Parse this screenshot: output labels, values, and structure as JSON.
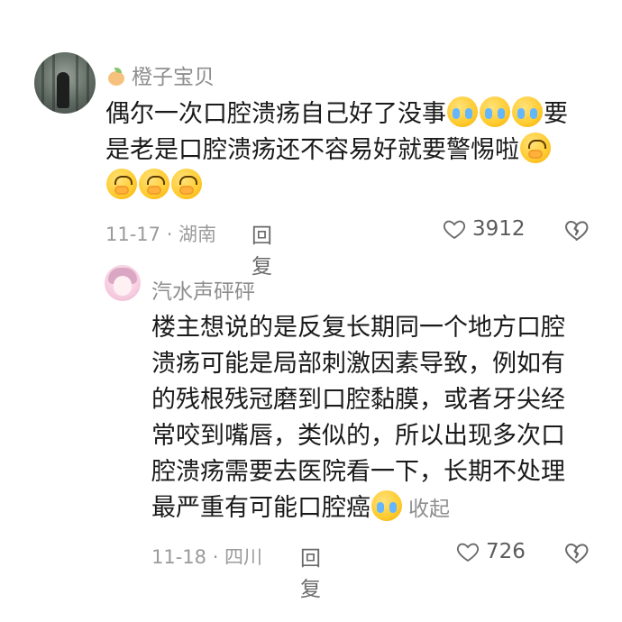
{
  "comment": {
    "username": "橙子宝贝",
    "text_line1": "偶尔一次口腔溃疡自己好了没事",
    "text_line1_after": "要",
    "text_line2": "是老是口腔溃疡还不容易好就要警惕啦",
    "date_location": "11-17 · 湖南",
    "reply_label": "回复",
    "likes": "3912"
  },
  "reply": {
    "username": "汽水声砰砰",
    "lines": [
      "楼主想说的是反复长期同一个地方口腔",
      "溃疡可能是局部刺激因素导致，例如有",
      "的残根残冠磨到口腔黏膜，或者牙尖经",
      "常咬到嘴唇，类似的，所以出现多次口",
      "腔溃疡需要去医院看一下，长期不处理",
      "最严重有可能口腔癌"
    ],
    "collapse_label": "收起",
    "date_location": "11-18 · 四川",
    "reply_label": "回复",
    "likes": "726"
  },
  "icons": {
    "like": "heart-outline-icon",
    "dislike": "broken-heart-icon",
    "emoji_cry": "crying-face-emoji",
    "emoji_cover": "face-covering-mouth-emoji"
  },
  "colors": {
    "meta_gray": "#9b9b9b",
    "text": "#1a1a1a",
    "username_gray": "#8e8e8e"
  }
}
